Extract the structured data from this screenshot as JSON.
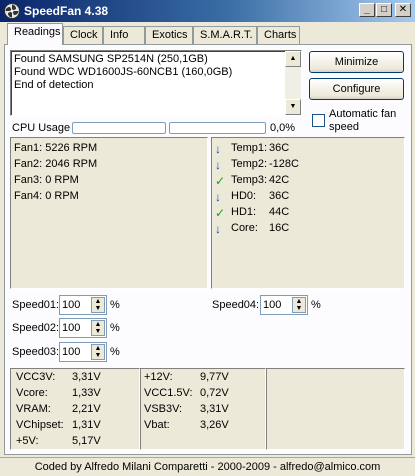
{
  "window": {
    "title": "SpeedFan 4.38",
    "minimize_glyph": "_",
    "maximize_glyph": "□",
    "close_glyph": "✕"
  },
  "tabs": [
    {
      "label": "Readings"
    },
    {
      "label": "Clock"
    },
    {
      "label": "Info"
    },
    {
      "label": "Exotics"
    },
    {
      "label": "S.M.A.R.T."
    },
    {
      "label": "Charts"
    }
  ],
  "log": {
    "lines": [
      "Found SAMSUNG SP2514N (250,1GB)",
      "Found WDC WD1600JS-60NCB1 (160,0GB)",
      "End of detection"
    ]
  },
  "buttons": {
    "minimize": "Minimize",
    "configure": "Configure"
  },
  "automatic_fan": {
    "label_line1": "Automatic fan",
    "label_line2": "speed",
    "checked": false
  },
  "cpu_usage": {
    "label": "CPU Usage",
    "value": "0,0%"
  },
  "fans": [
    {
      "label": "Fan1:",
      "value": "5226 RPM"
    },
    {
      "label": "Fan2:",
      "value": "2046 RPM"
    },
    {
      "label": "Fan3:",
      "value": "0 RPM"
    },
    {
      "label": "Fan4:",
      "value": "0 RPM"
    }
  ],
  "temps": [
    {
      "label": "Temp1:",
      "value": "36C",
      "status": "down",
      "icon": "arrow-down-icon"
    },
    {
      "label": "Temp2:",
      "value": "-128C",
      "status": "down",
      "icon": "arrow-down-icon"
    },
    {
      "label": "Temp3:",
      "value": "42C",
      "status": "ok",
      "icon": "checkmark-icon"
    },
    {
      "label": "HD0:",
      "value": "36C",
      "status": "down",
      "icon": "arrow-down-icon"
    },
    {
      "label": "HD1:",
      "value": "44C",
      "status": "ok",
      "icon": "checkmark-icon"
    },
    {
      "label": "Core:",
      "value": "16C",
      "status": "down",
      "icon": "arrow-down-icon"
    }
  ],
  "status_glyphs": {
    "down": "↓",
    "ok": "✓"
  },
  "speeds": {
    "speed01": {
      "label": "Speed01:",
      "value": "100",
      "unit": "%"
    },
    "speed02": {
      "label": "Speed02:",
      "value": "100",
      "unit": "%"
    },
    "speed03": {
      "label": "Speed03:",
      "value": "100",
      "unit": "%"
    },
    "speed04": {
      "label": "Speed04:",
      "value": "100",
      "unit": "%"
    }
  },
  "spin_glyphs": {
    "up": "▲",
    "down": "▼"
  },
  "scroll_glyphs": {
    "up": "▲",
    "down": "▼"
  },
  "voltages_col1": [
    {
      "label": "VCC3V:",
      "value": "3,31V"
    },
    {
      "label": "Vcore:",
      "value": "1,33V"
    },
    {
      "label": "VRAM:",
      "value": "2,21V"
    },
    {
      "label": "VChipset:",
      "value": "1,31V"
    },
    {
      "label": "+5V:",
      "value": "5,17V"
    }
  ],
  "voltages_col2": [
    {
      "label": "+12V:",
      "value": "9,77V"
    },
    {
      "label": "VCC1.5V:",
      "value": "0,72V"
    },
    {
      "label": "VSB3V:",
      "value": "3,31V"
    },
    {
      "label": "Vbat:",
      "value": "3,26V"
    }
  ],
  "status_bar": "Coded by Alfredo Milani Comparetti - 2000-2009 - alfredo@almico.com",
  "colors": {
    "titlebar_start": "#0a246a",
    "titlebar_end": "#a6caf0",
    "arrow_blue": "#1a3fd6",
    "check_green": "#1a9e1a"
  }
}
